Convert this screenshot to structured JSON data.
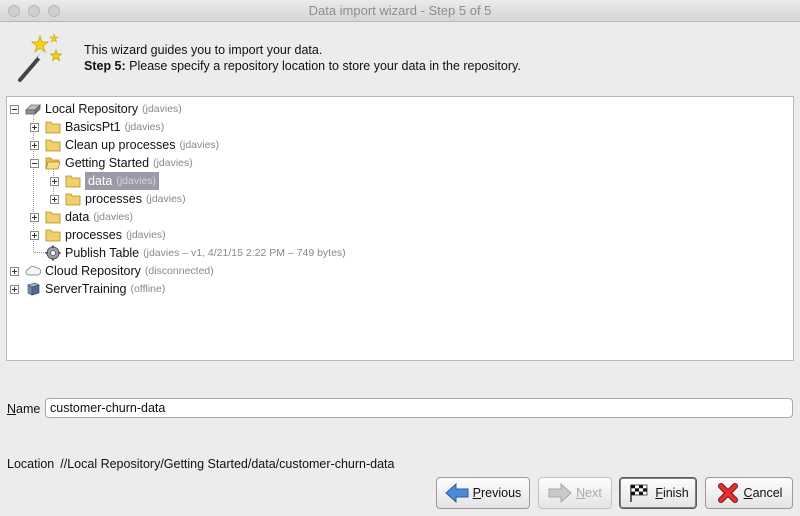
{
  "window": {
    "title": "Data import wizard - Step 5 of 5"
  },
  "header": {
    "line1": "This wizard guides you to import your data.",
    "step_label": "Step 5:",
    "step_text": " Please specify a repository location to store your data in the repository."
  },
  "tree": {
    "local_repo": {
      "label": "Local Repository",
      "meta": "(jdavies)"
    },
    "basics": {
      "label": "BasicsPt1",
      "meta": "(jdavies)"
    },
    "cleanup": {
      "label": "Clean up processes",
      "meta": "(jdavies)"
    },
    "getting_started": {
      "label": "Getting Started",
      "meta": "(jdavies)"
    },
    "gs_data": {
      "label": "data",
      "meta": "(jdavies)"
    },
    "gs_processes": {
      "label": "processes",
      "meta": "(jdavies)"
    },
    "data": {
      "label": "data",
      "meta": "(jdavies)"
    },
    "processes": {
      "label": "processes",
      "meta": "(jdavies)"
    },
    "publish_table": {
      "label": "Publish Table",
      "meta": "(jdavies – v1, 4/21/15 2:22 PM – 749 bytes)"
    },
    "cloud_repo": {
      "label": "Cloud Repository",
      "meta": "(disconnected)"
    },
    "server_training": {
      "label": "ServerTraining",
      "meta": "(offline)"
    }
  },
  "name": {
    "label_first": "N",
    "label_rest": "ame",
    "value": "customer-churn-data"
  },
  "location": {
    "label": "Location",
    "value": "//Local Repository/Getting Started/data/customer-churn-data"
  },
  "buttons": {
    "previous_first": "P",
    "previous_rest": "revious",
    "next_first": "N",
    "next_rest": "ext",
    "finish_first": "F",
    "finish_rest": "inish",
    "cancel_first": "C",
    "cancel_rest": "ancel"
  }
}
